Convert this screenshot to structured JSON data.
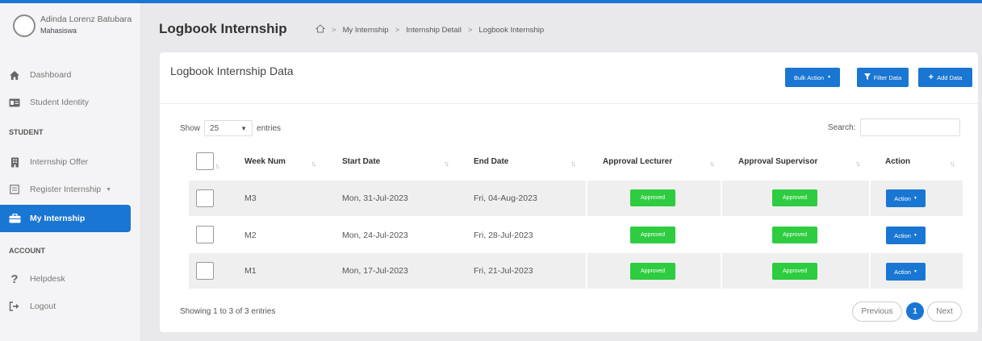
{
  "user": {
    "name": "Adinda Lorenz Batubara",
    "role": "Mahasiswa"
  },
  "sidebar": {
    "items": [
      {
        "label": "Dashboard",
        "icon": "home-icon"
      },
      {
        "label": "Student Identity",
        "icon": "id-card-icon"
      },
      {
        "label": "Internship Offer",
        "icon": "building-icon"
      },
      {
        "label": "Register Internship",
        "icon": "form-icon"
      },
      {
        "label": "My Internship",
        "icon": "briefcase-icon"
      },
      {
        "label": "Helpdesk",
        "icon": "question-icon"
      },
      {
        "label": "Logout",
        "icon": "logout-icon"
      }
    ],
    "sections": [
      "STUDENT",
      "ACCOUNT"
    ],
    "active_color": "#1976d2"
  },
  "header": {
    "title": "Logbook Internship",
    "breadcrumb": [
      "My Internship",
      "Internship Detail",
      "Logbook Internship"
    ]
  },
  "card": {
    "title": "Logbook Internship Data",
    "bulk_action": "Bulk Action",
    "filter": "Filter Data",
    "add": "Add Data"
  },
  "table": {
    "show_label": "Show",
    "entries_value": "25",
    "entries_label": "entries",
    "search_label": "Search:",
    "columns": [
      "Week Num",
      "Start Date",
      "End Date",
      "Approval Lecturer",
      "Approval Supervisor",
      "Action"
    ],
    "rows": [
      {
        "week": "M3",
        "start": "Mon, 31-Jul-2023",
        "end": "Fri, 04-Aug-2023",
        "lecturer": "Approved",
        "supervisor": "Approved",
        "action": "Action"
      },
      {
        "week": "M2",
        "start": "Mon, 24-Jul-2023",
        "end": "Fri, 28-Jul-2023",
        "lecturer": "Approved",
        "supervisor": "Approved",
        "action": "Action"
      },
      {
        "week": "M1",
        "start": "Mon, 17-Jul-2023",
        "end": "Fri, 21-Jul-2023",
        "lecturer": "Approved",
        "supervisor": "Approved",
        "action": "Action"
      }
    ],
    "info": "Showing 1 to 3 of 3 entries"
  },
  "pagination": {
    "previous": "Previous",
    "current": "1",
    "next": "Next"
  },
  "colors": {
    "primary": "#1976d2",
    "approved": "#2ecc40"
  }
}
